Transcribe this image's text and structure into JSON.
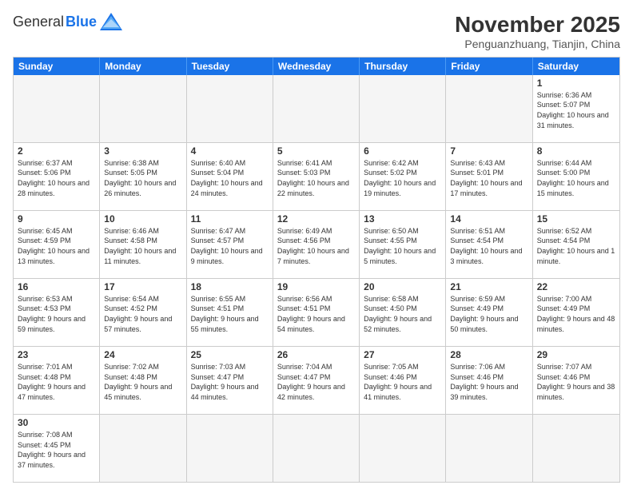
{
  "logo": {
    "general": "General",
    "blue": "Blue"
  },
  "title": "November 2025",
  "location": "Penguanzhuang, Tianjin, China",
  "header_days": [
    "Sunday",
    "Monday",
    "Tuesday",
    "Wednesday",
    "Thursday",
    "Friday",
    "Saturday"
  ],
  "weeks": [
    [
      {
        "day": "",
        "info": ""
      },
      {
        "day": "",
        "info": ""
      },
      {
        "day": "",
        "info": ""
      },
      {
        "day": "",
        "info": ""
      },
      {
        "day": "",
        "info": ""
      },
      {
        "day": "",
        "info": ""
      },
      {
        "day": "1",
        "info": "Sunrise: 6:36 AM\nSunset: 5:07 PM\nDaylight: 10 hours and 31 minutes."
      }
    ],
    [
      {
        "day": "2",
        "info": "Sunrise: 6:37 AM\nSunset: 5:06 PM\nDaylight: 10 hours and 28 minutes."
      },
      {
        "day": "3",
        "info": "Sunrise: 6:38 AM\nSunset: 5:05 PM\nDaylight: 10 hours and 26 minutes."
      },
      {
        "day": "4",
        "info": "Sunrise: 6:40 AM\nSunset: 5:04 PM\nDaylight: 10 hours and 24 minutes."
      },
      {
        "day": "5",
        "info": "Sunrise: 6:41 AM\nSunset: 5:03 PM\nDaylight: 10 hours and 22 minutes."
      },
      {
        "day": "6",
        "info": "Sunrise: 6:42 AM\nSunset: 5:02 PM\nDaylight: 10 hours and 19 minutes."
      },
      {
        "day": "7",
        "info": "Sunrise: 6:43 AM\nSunset: 5:01 PM\nDaylight: 10 hours and 17 minutes."
      },
      {
        "day": "8",
        "info": "Sunrise: 6:44 AM\nSunset: 5:00 PM\nDaylight: 10 hours and 15 minutes."
      }
    ],
    [
      {
        "day": "9",
        "info": "Sunrise: 6:45 AM\nSunset: 4:59 PM\nDaylight: 10 hours and 13 minutes."
      },
      {
        "day": "10",
        "info": "Sunrise: 6:46 AM\nSunset: 4:58 PM\nDaylight: 10 hours and 11 minutes."
      },
      {
        "day": "11",
        "info": "Sunrise: 6:47 AM\nSunset: 4:57 PM\nDaylight: 10 hours and 9 minutes."
      },
      {
        "day": "12",
        "info": "Sunrise: 6:49 AM\nSunset: 4:56 PM\nDaylight: 10 hours and 7 minutes."
      },
      {
        "day": "13",
        "info": "Sunrise: 6:50 AM\nSunset: 4:55 PM\nDaylight: 10 hours and 5 minutes."
      },
      {
        "day": "14",
        "info": "Sunrise: 6:51 AM\nSunset: 4:54 PM\nDaylight: 10 hours and 3 minutes."
      },
      {
        "day": "15",
        "info": "Sunrise: 6:52 AM\nSunset: 4:54 PM\nDaylight: 10 hours and 1 minute."
      }
    ],
    [
      {
        "day": "16",
        "info": "Sunrise: 6:53 AM\nSunset: 4:53 PM\nDaylight: 9 hours and 59 minutes."
      },
      {
        "day": "17",
        "info": "Sunrise: 6:54 AM\nSunset: 4:52 PM\nDaylight: 9 hours and 57 minutes."
      },
      {
        "day": "18",
        "info": "Sunrise: 6:55 AM\nSunset: 4:51 PM\nDaylight: 9 hours and 55 minutes."
      },
      {
        "day": "19",
        "info": "Sunrise: 6:56 AM\nSunset: 4:51 PM\nDaylight: 9 hours and 54 minutes."
      },
      {
        "day": "20",
        "info": "Sunrise: 6:58 AM\nSunset: 4:50 PM\nDaylight: 9 hours and 52 minutes."
      },
      {
        "day": "21",
        "info": "Sunrise: 6:59 AM\nSunset: 4:49 PM\nDaylight: 9 hours and 50 minutes."
      },
      {
        "day": "22",
        "info": "Sunrise: 7:00 AM\nSunset: 4:49 PM\nDaylight: 9 hours and 48 minutes."
      }
    ],
    [
      {
        "day": "23",
        "info": "Sunrise: 7:01 AM\nSunset: 4:48 PM\nDaylight: 9 hours and 47 minutes."
      },
      {
        "day": "24",
        "info": "Sunrise: 7:02 AM\nSunset: 4:48 PM\nDaylight: 9 hours and 45 minutes."
      },
      {
        "day": "25",
        "info": "Sunrise: 7:03 AM\nSunset: 4:47 PM\nDaylight: 9 hours and 44 minutes."
      },
      {
        "day": "26",
        "info": "Sunrise: 7:04 AM\nSunset: 4:47 PM\nDaylight: 9 hours and 42 minutes."
      },
      {
        "day": "27",
        "info": "Sunrise: 7:05 AM\nSunset: 4:46 PM\nDaylight: 9 hours and 41 minutes."
      },
      {
        "day": "28",
        "info": "Sunrise: 7:06 AM\nSunset: 4:46 PM\nDaylight: 9 hours and 39 minutes."
      },
      {
        "day": "29",
        "info": "Sunrise: 7:07 AM\nSunset: 4:46 PM\nDaylight: 9 hours and 38 minutes."
      }
    ],
    [
      {
        "day": "30",
        "info": "Sunrise: 7:08 AM\nSunset: 4:45 PM\nDaylight: 9 hours and 37 minutes."
      },
      {
        "day": "",
        "info": ""
      },
      {
        "day": "",
        "info": ""
      },
      {
        "day": "",
        "info": ""
      },
      {
        "day": "",
        "info": ""
      },
      {
        "day": "",
        "info": ""
      },
      {
        "day": "",
        "info": ""
      }
    ]
  ]
}
